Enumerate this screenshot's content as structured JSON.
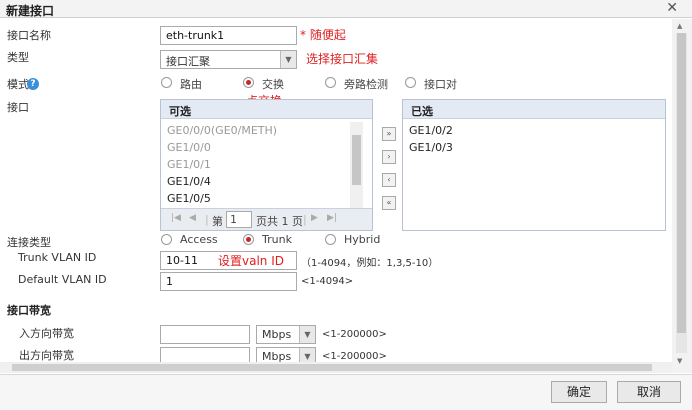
{
  "dialog": {
    "title": "新建接口"
  },
  "form": {
    "name_label": "接口名称",
    "name_value": "eth-trunk1",
    "name_note": "* 随便起",
    "type_label": "类型",
    "type_value": "接口汇聚",
    "type_note": "选择接口汇集",
    "mode_label": "模式",
    "mode_options": [
      "路由",
      "交换",
      "旁路检测",
      "接口对"
    ],
    "mode_selected": "交换",
    "mode_note": "点交换",
    "ports_label": "接口",
    "available_header": "可选",
    "available_items": [
      "GE0/0/0(GE0/METH)",
      "GE1/0/0",
      "GE1/0/1",
      "GE1/0/4",
      "GE1/0/5"
    ],
    "selected_header": "已选",
    "selected_items": [
      "GE1/0/2",
      "GE1/0/3"
    ],
    "pager": {
      "page_prefix": "第",
      "page_value": "1",
      "page_suffix": "页共 1 页"
    },
    "link_type_label": "连接类型",
    "link_options": [
      "Access",
      "Trunk",
      "Hybrid"
    ],
    "link_selected": "Trunk",
    "trunk_vlan_label": "Trunk VLAN ID",
    "trunk_vlan_value": "10-11",
    "trunk_vlan_note": "设置valn ID",
    "trunk_vlan_hint": "（1-4094，例如：1,3,5-10）",
    "default_vlan_label": "Default VLAN ID",
    "default_vlan_value": "1",
    "default_vlan_hint": "<1-4094>",
    "bandwidth_section": "接口带宽",
    "in_bw_label": "入方向带宽",
    "out_bw_label": "出方向带宽",
    "bw_unit": "Mbps",
    "bw_hint": "<1-200000>"
  },
  "footer": {
    "ok_label": "确定",
    "cancel_label": "取消"
  },
  "colors": {
    "annotation": "#e02020",
    "radio_selected": "#c62828",
    "help_icon": "#3a8fd8"
  },
  "icons": {
    "close": "close-icon",
    "help": "help-icon",
    "dropdown": "chevron-down-icon"
  }
}
